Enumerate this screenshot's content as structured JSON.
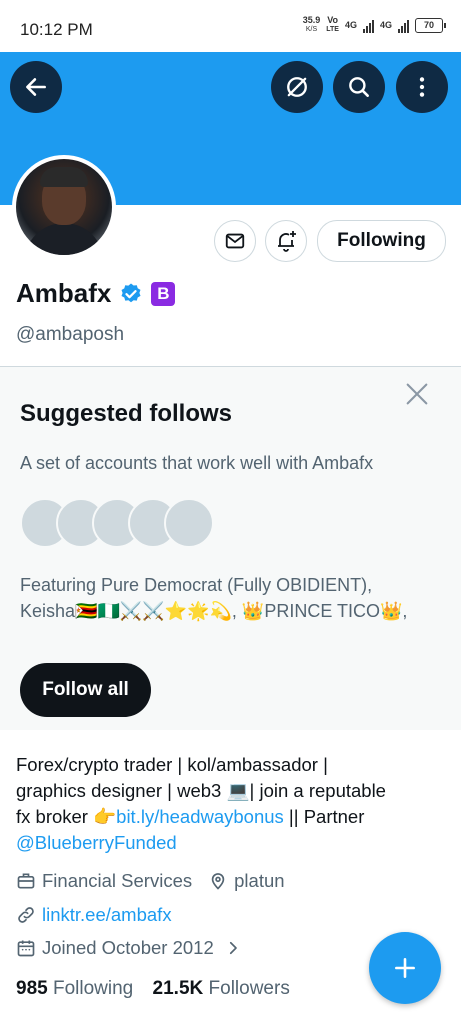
{
  "status_bar": {
    "time": "10:12 PM",
    "speed_value": "35.9",
    "speed_unit": "K/S",
    "volte_top": "Vo",
    "volte_bottom": "LTE",
    "net1": "4G",
    "net2": "4G",
    "battery": "70"
  },
  "header": {
    "back_icon": "arrow-left-icon",
    "mute_icon": "slashed-circle-icon",
    "search_icon": "search-icon",
    "more_icon": "more-vertical-icon",
    "banner_color": "#1d9bf0"
  },
  "profile": {
    "name": "Ambafx",
    "handle": "@ambaposh",
    "following_button": "Following",
    "verified_color": "#1d9bf0",
    "badge_letter": "B"
  },
  "suggested": {
    "title": "Suggested follows",
    "description": "A set of accounts that work well with Ambafx",
    "featuring_line1": "Featuring Pure Democrat (Fully OBIDIENT),",
    "featuring_line2": "Keisha🇿🇼🇳🇬⚔️⚔️⭐🌟💫, 👑PRINCE TICO👑,",
    "follow_all": "Follow all"
  },
  "bio": {
    "line1": "Forex/crypto trader | kol/ambassador |",
    "line2": "graphics designer | web3 💻|  join a reputable",
    "line3_prefix": "fx broker 👉",
    "line3_link": "bit.ly/headwaybonus",
    "line3_suffix": " || Partner",
    "line4_mention": "@BlueberryFunded"
  },
  "details": {
    "category": "Financial Services",
    "location": "platun",
    "website": "linktr.ee/ambafx",
    "joined": "Joined October 2012"
  },
  "stats": {
    "following_count": "985",
    "following_label": "Following",
    "followers_count": "21.5K",
    "followers_label": "Followers"
  },
  "compose": {
    "icon": "plus-icon"
  }
}
